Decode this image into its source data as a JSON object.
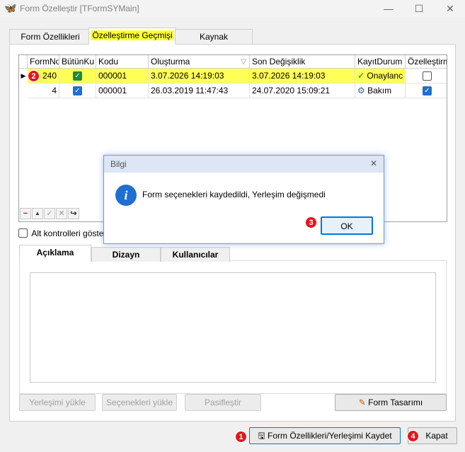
{
  "window": {
    "title": "Form Özelleştir [TFormSYMain]",
    "minimize": "—",
    "maximize": "☐",
    "close": "✕"
  },
  "tabs": [
    "Form Özellikleri",
    "Özelleştirme Geçmişi",
    "Kaynak"
  ],
  "grid": {
    "columns": [
      "FormNo",
      "BütünKu",
      "Kodu",
      "Oluşturma",
      "Son Değişiklik",
      "KayıtDurum",
      "Özelleştirm"
    ],
    "rows": [
      {
        "formno": "240",
        "butun": true,
        "kodu": "000001",
        "olusturma": "3.07.2026 14:19:03",
        "son": "3.07.2026 14:19:03",
        "durum": "Onaylanc",
        "ozel": false
      },
      {
        "formno": "4",
        "butun": true,
        "kodu": "000001",
        "olusturma": "26.03.2019 11:47:43",
        "son": "24.07.2020 15:09:21",
        "durum": "Bakım",
        "ozel": true
      }
    ]
  },
  "checkbox_label": "Alt kontrolleri göste",
  "subtabs": [
    "Açıklama",
    "Dizayn",
    "Kullanıcılar"
  ],
  "buttons": {
    "yerlesim_yukle": "Yerleşimi yükle",
    "secenek_yukle": "Seçenekleri yükle",
    "pasiflestir": "Pasifleştir",
    "form_tasarimi": "Form Tasarımı",
    "kaydet": "Form Özellikleri/Yerleşimi Kaydet",
    "kapat": "Kapat"
  },
  "dialog": {
    "title": "Bilgi",
    "message": "Form seçenekleri kaydedildi, Yerleşim değişmedi",
    "ok": "OK"
  },
  "badges": [
    "1",
    "2",
    "3",
    "4"
  ],
  "colors": {
    "highlight": "#ffff33",
    "accent": "#0078d7",
    "badge": "#e8131a"
  }
}
